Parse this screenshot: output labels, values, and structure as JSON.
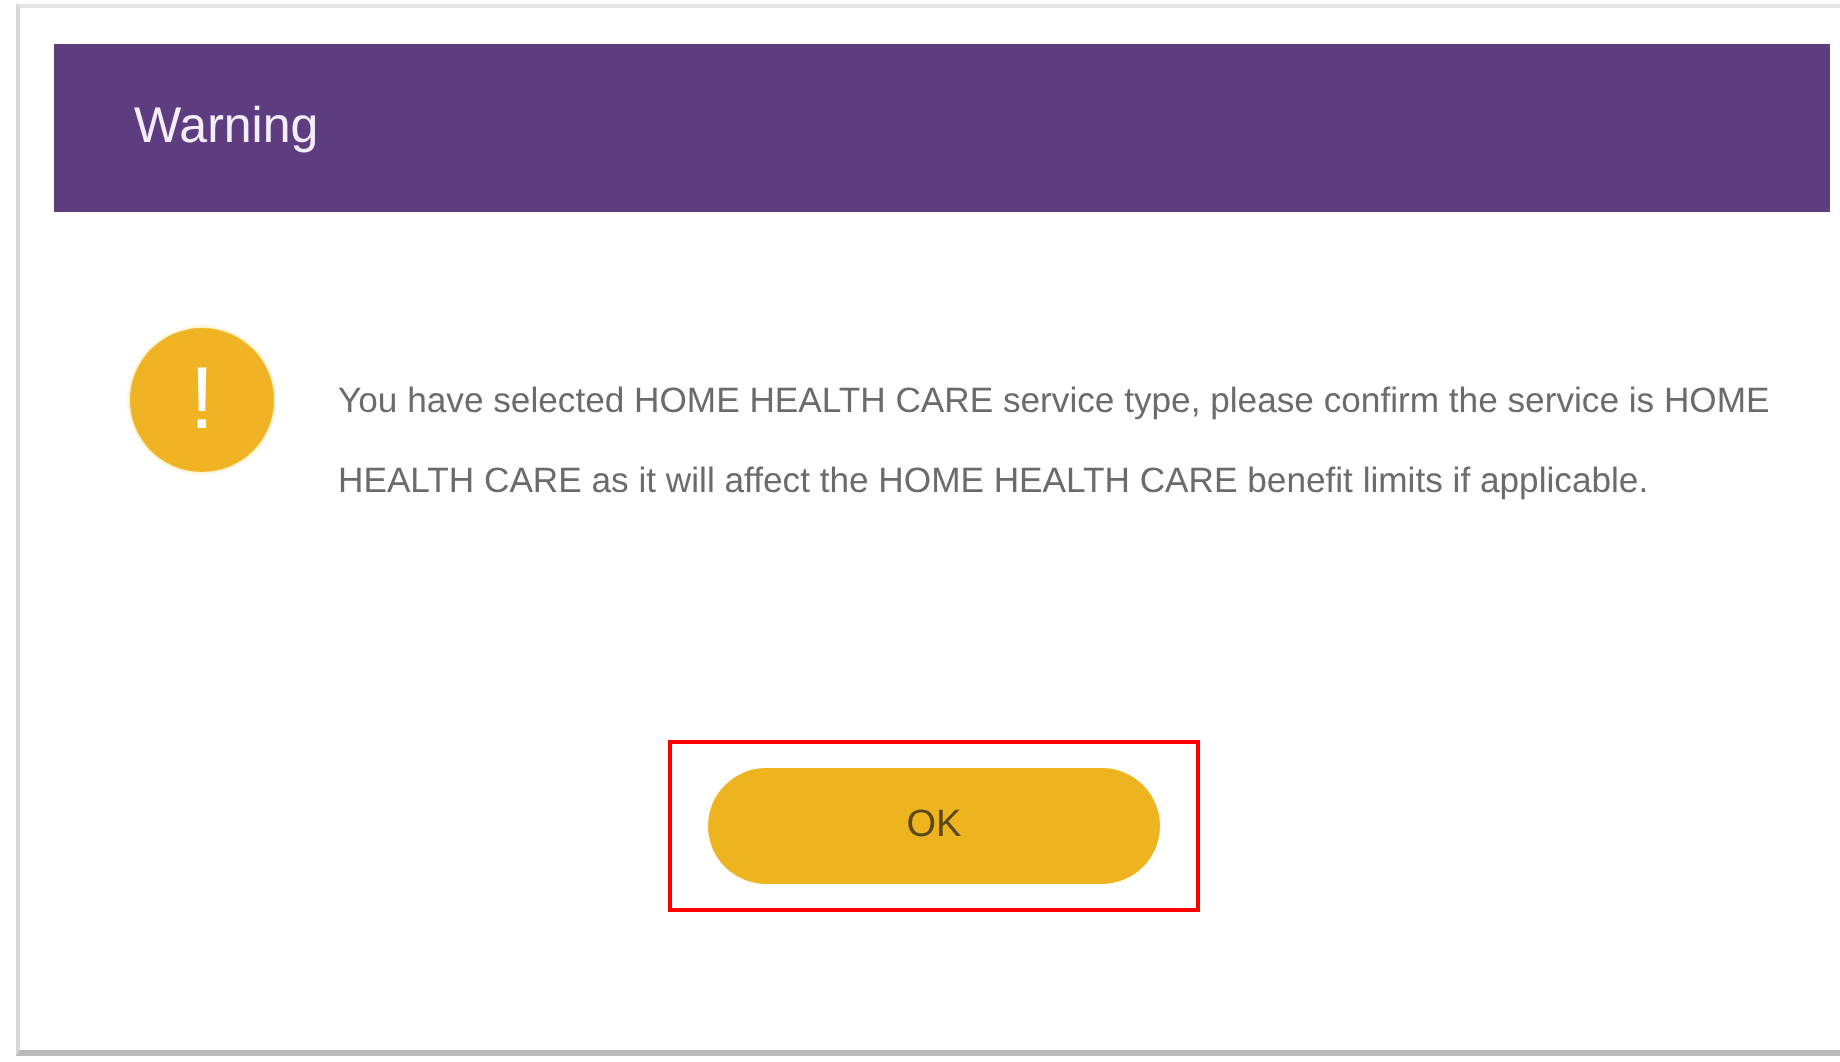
{
  "dialog": {
    "title": "Warning",
    "message": "You have selected HOME HEALTH CARE service type, please confirm the service is HOME HEALTH CARE as it will affect the HOME HEALTH CARE benefit limits if applicable.",
    "icon_glyph": "!",
    "button": {
      "label": "OK",
      "highlighted": true
    }
  }
}
